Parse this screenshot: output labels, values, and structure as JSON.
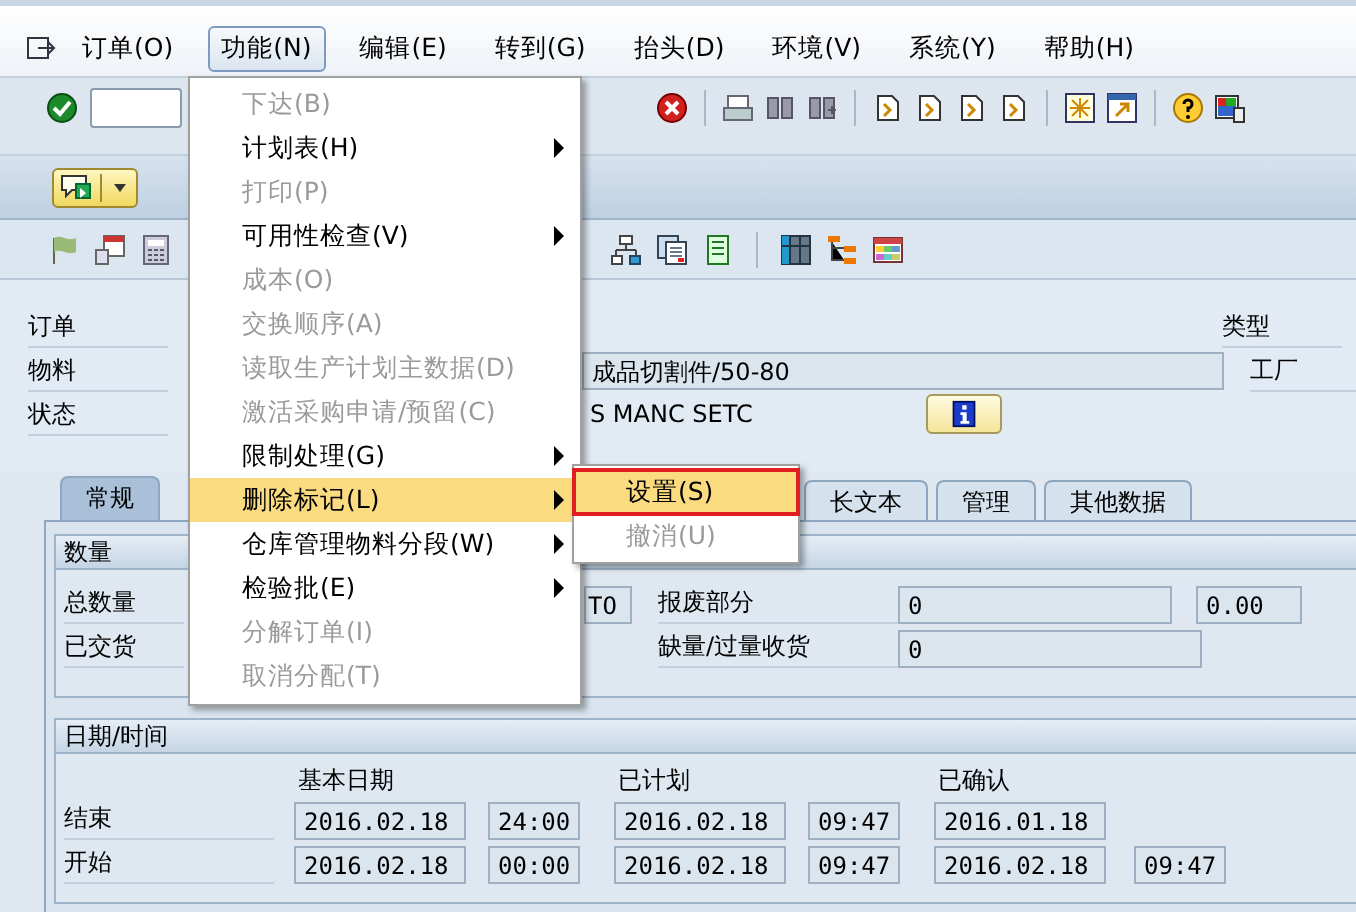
{
  "menubar": {
    "items": [
      {
        "label": "订单(O)",
        "selected": false
      },
      {
        "label": "功能(N)",
        "selected": true
      },
      {
        "label": "编辑(E)",
        "selected": false
      },
      {
        "label": "转到(G)",
        "selected": false
      },
      {
        "label": "抬头(D)",
        "selected": false
      },
      {
        "label": "环境(V)",
        "selected": false
      },
      {
        "label": "系统(Y)",
        "selected": false
      },
      {
        "label": "帮助(H)",
        "selected": false
      }
    ]
  },
  "header": {
    "order_label": "订单",
    "material_label": "物料",
    "material_value": "成品切割件/50-80",
    "status_label": "状态",
    "status_value": "S MANC SETC",
    "type_label": "类型",
    "plant_label": "工厂"
  },
  "tabs": [
    {
      "label": "常规",
      "selected": true
    },
    {
      "label": "长文本",
      "selected": false
    },
    {
      "label": "管理",
      "selected": false
    },
    {
      "label": "其他数据",
      "selected": false
    }
  ],
  "quantities": {
    "title": "数量",
    "total_label": "总数量",
    "total_unit": "TO",
    "scrap_label": "报废部分",
    "scrap_value": "0",
    "scrap_percent": "0.00",
    "delivered_label": "已交货",
    "shortage_label": "缺量/过量收货",
    "shortage_value": "0"
  },
  "dates": {
    "title": "日期/时间",
    "columns": [
      "基本日期",
      "已计划",
      "已确认"
    ],
    "rows": [
      {
        "label": "结束",
        "cells": [
          {
            "date": "2016.02.18",
            "time": "24:00"
          },
          {
            "date": "2016.02.18",
            "time": "09:47"
          },
          {
            "date": "2016.01.18"
          }
        ]
      },
      {
        "label": "开始",
        "cells": [
          {
            "date": "2016.02.18",
            "time": "00:00"
          },
          {
            "date": "2016.02.18",
            "time": "09:47"
          },
          {
            "date": "2016.02.18",
            "time": "09:47"
          }
        ]
      }
    ]
  },
  "function_menu": {
    "items": [
      {
        "label": "下达(B)",
        "disabled": true,
        "has_submenu": false,
        "selected": false
      },
      {
        "label": "计划表(H)",
        "disabled": false,
        "has_submenu": true,
        "selected": false
      },
      {
        "label": "打印(P)",
        "disabled": true,
        "has_submenu": false,
        "selected": false
      },
      {
        "label": "可用性检查(V)",
        "disabled": false,
        "has_submenu": true,
        "selected": false
      },
      {
        "label": "成本(O)",
        "disabled": true,
        "has_submenu": false,
        "selected": false
      },
      {
        "label": "交换顺序(A)",
        "disabled": true,
        "has_submenu": false,
        "selected": false
      },
      {
        "label": "读取生产计划主数据(D)",
        "disabled": true,
        "has_submenu": false,
        "selected": false
      },
      {
        "label": "激活采购申请/预留(C)",
        "disabled": true,
        "has_submenu": false,
        "selected": false
      },
      {
        "label": "限制处理(G)",
        "disabled": false,
        "has_submenu": true,
        "selected": false
      },
      {
        "label": "删除标记(L)",
        "disabled": false,
        "has_submenu": true,
        "selected": true
      },
      {
        "label": "仓库管理物料分段(W)",
        "disabled": false,
        "has_submenu": true,
        "selected": false
      },
      {
        "label": "检验批(E)",
        "disabled": false,
        "has_submenu": true,
        "selected": false
      },
      {
        "label": "分解订单(I)",
        "disabled": true,
        "has_submenu": false,
        "selected": false
      },
      {
        "label": "取消分配(T)",
        "disabled": true,
        "has_submenu": false,
        "selected": false
      }
    ]
  },
  "submenu": {
    "items": [
      {
        "label": "设置(S)",
        "disabled": false,
        "selected": true,
        "annotated": true
      },
      {
        "label": "撤消(U)",
        "disabled": true,
        "selected": false,
        "annotated": false
      }
    ]
  }
}
